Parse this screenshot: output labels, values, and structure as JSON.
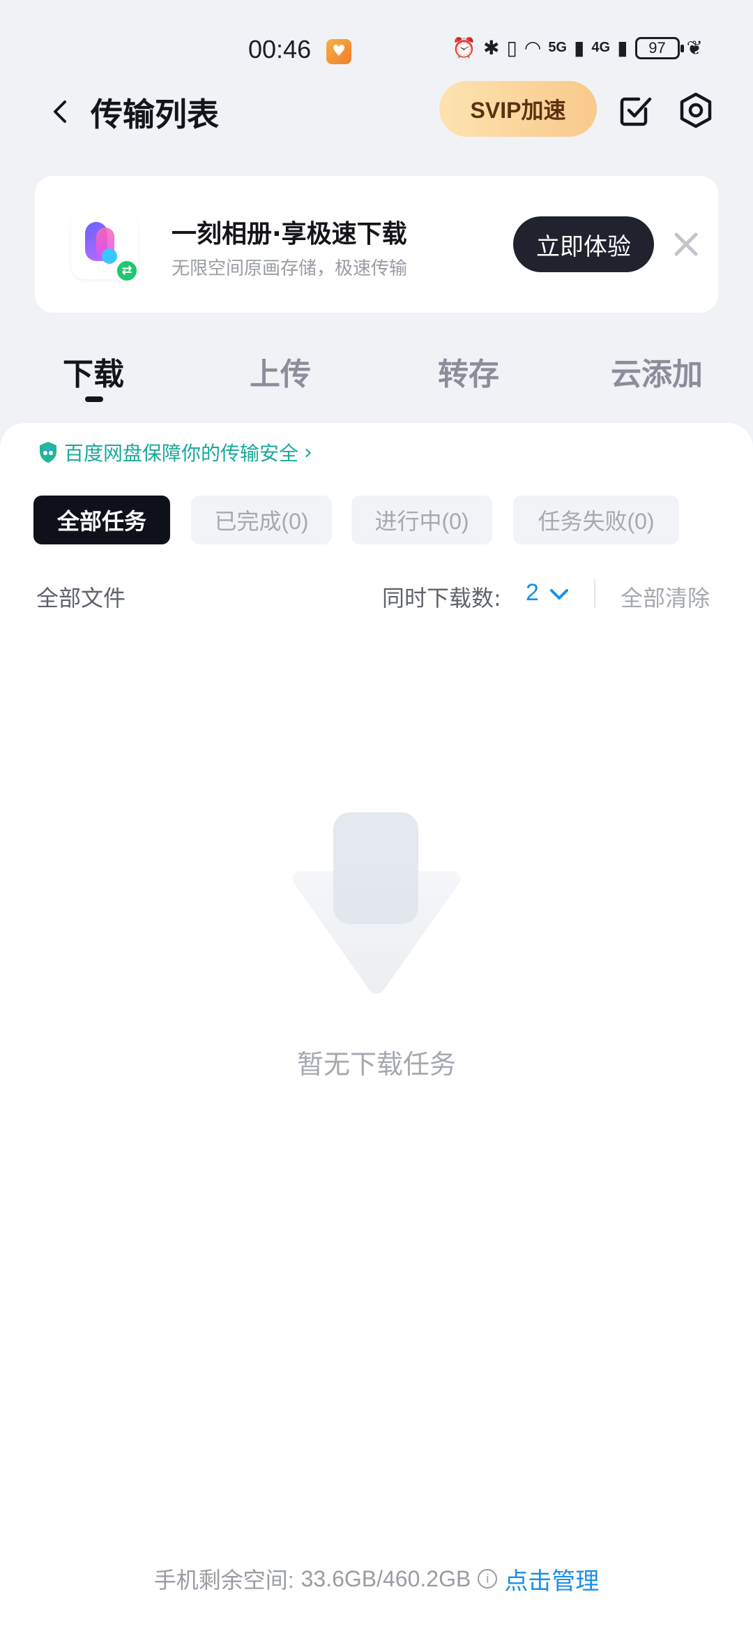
{
  "status_bar": {
    "time": "00:46",
    "network_1": "5G",
    "network_2": "4G",
    "battery": "97"
  },
  "header": {
    "title": "传输列表",
    "svip_label": "SVIP加速"
  },
  "promo": {
    "title": "一刻相册·享极速下载",
    "subtitle": "无限空间原画存储，极速传输",
    "cta_label": "立即体验"
  },
  "tabs": [
    {
      "label": "下载",
      "active": true
    },
    {
      "label": "上传",
      "active": false
    },
    {
      "label": "转存",
      "active": false
    },
    {
      "label": "云添加",
      "active": false
    }
  ],
  "safety_notice": "百度网盘保障你的传输安全",
  "filters": [
    {
      "label": "全部任务",
      "active": true
    },
    {
      "label": "已完成(0)",
      "active": false
    },
    {
      "label": "进行中(0)",
      "active": false
    },
    {
      "label": "任务失败(0)",
      "active": false
    }
  ],
  "list_header": {
    "all_files": "全部文件",
    "concurrent_label": "同时下载数:",
    "concurrent_value": "2",
    "clear_all": "全部清除"
  },
  "empty_state": {
    "message": "暂无下载任务"
  },
  "footer": {
    "storage_label": "手机剩余空间:",
    "storage_value": "33.6GB/460.2GB",
    "manage_label": "点击管理"
  },
  "colors": {
    "background": "#f1f2f6",
    "accent_blue": "#1a8fe8",
    "safety_green": "#1aa99a",
    "svip_gold": "#f9c98a",
    "dark": "#14151a"
  }
}
